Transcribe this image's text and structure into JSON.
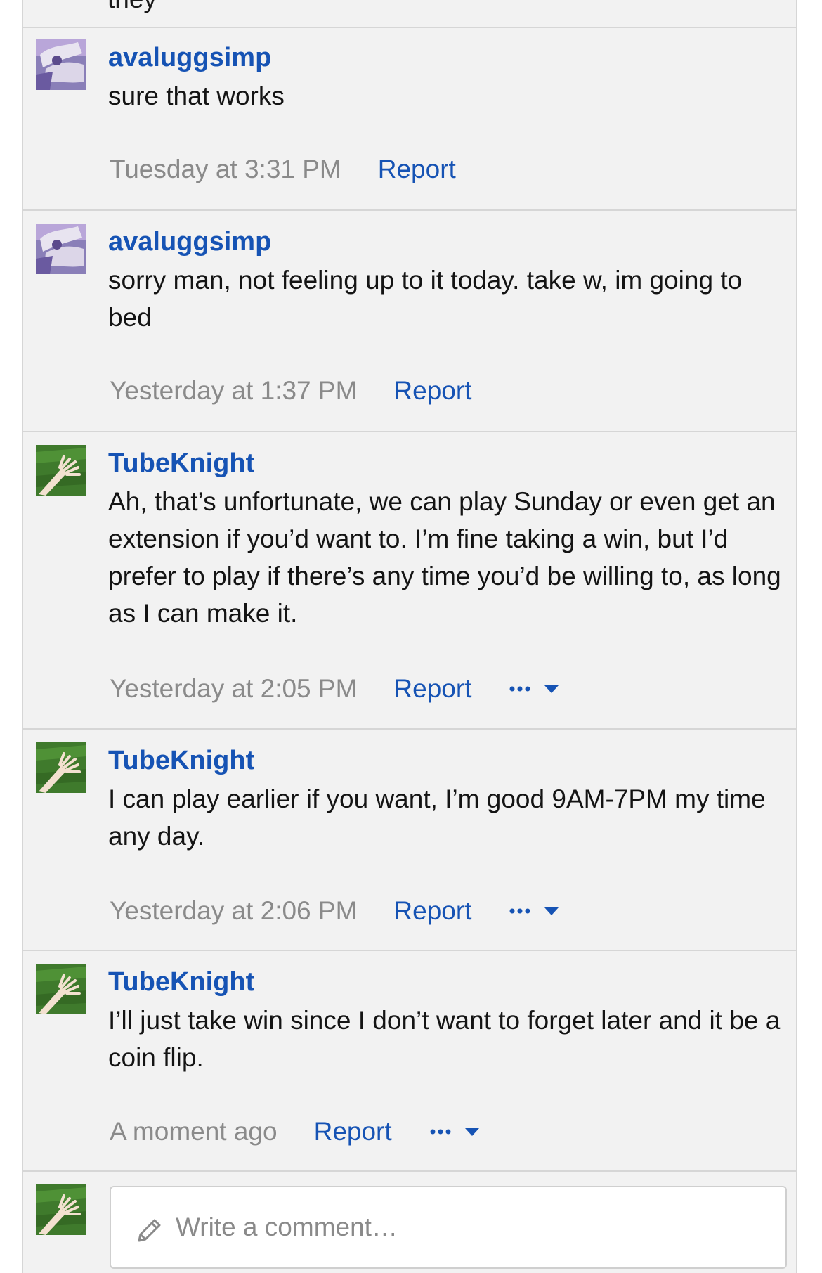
{
  "thread": {
    "top_stub_text": "they",
    "comments": [
      {
        "author": "avaluggsimp",
        "avatar": "avaluggsimp-avatar",
        "body": "sure that works",
        "timestamp": "Tuesday at 3:31 PM",
        "report_label": "Report",
        "has_more_menu": false
      },
      {
        "author": "avaluggsimp",
        "avatar": "avaluggsimp-avatar",
        "body": "sorry man, not feeling up to it today. take w, im going to bed",
        "timestamp": "Yesterday at 1:37 PM",
        "report_label": "Report",
        "has_more_menu": false
      },
      {
        "author": "TubeKnight",
        "avatar": "tubeknight-avatar",
        "body": "Ah, that’s unfortunate, we can play Sunday or even get an extension if you’d want to. I’m fine taking a win, but I’d prefer to play if there’s any time you’d be willing to, as long as I can make it.",
        "timestamp": "Yesterday at 2:05 PM",
        "report_label": "Report",
        "has_more_menu": true
      },
      {
        "author": "TubeKnight",
        "avatar": "tubeknight-avatar",
        "body": "I can play earlier if you want, I’m good 9AM-7PM my time any day.",
        "timestamp": "Yesterday at 2:06 PM",
        "report_label": "Report",
        "has_more_menu": true
      },
      {
        "author": "TubeKnight",
        "avatar": "tubeknight-avatar",
        "body": "I’ll just take win since I don’t want to forget later and it be a coin flip.",
        "timestamp": "A moment ago",
        "report_label": "Report",
        "has_more_menu": true
      }
    ]
  },
  "composer": {
    "placeholder": "Write a comment…",
    "avatar": "tubeknight-avatar",
    "icon": "pencil-icon"
  },
  "colors": {
    "link": "#1653b4",
    "muted": "#8a8a8a",
    "panel_bg": "#f2f2f2",
    "divider": "#d6d6d6"
  }
}
